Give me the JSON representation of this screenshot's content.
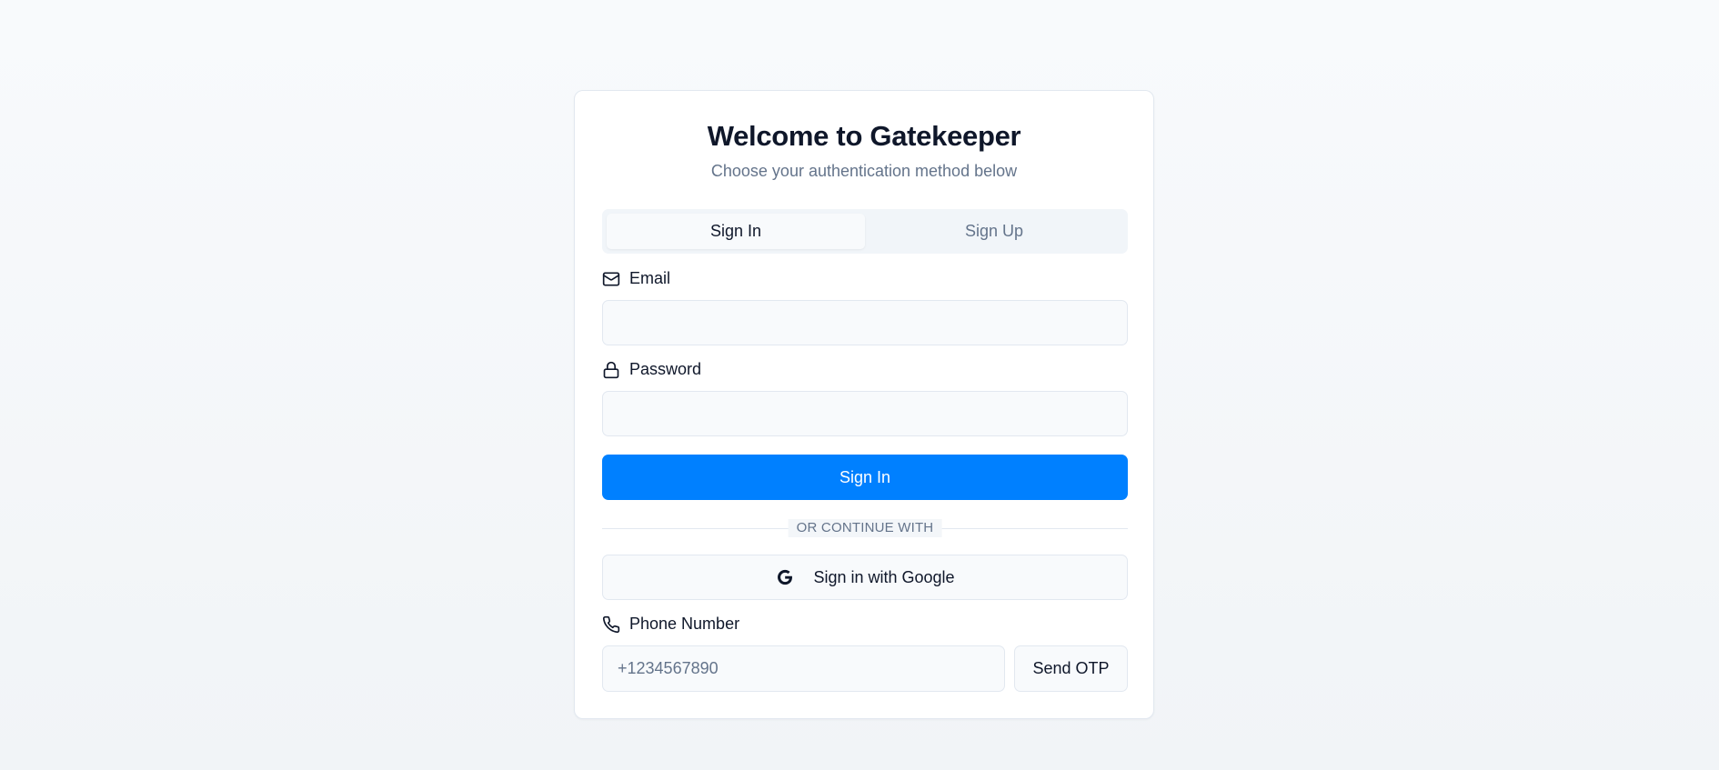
{
  "header": {
    "title": "Welcome to Gatekeeper",
    "subtitle": "Choose your authentication method below"
  },
  "tabs": [
    {
      "label": "Sign In",
      "active": true
    },
    {
      "label": "Sign Up",
      "active": false
    }
  ],
  "email": {
    "label": "Email",
    "icon": "mail-icon",
    "value": "",
    "placeholder": ""
  },
  "password": {
    "label": "Password",
    "icon": "lock-icon",
    "value": "",
    "placeholder": ""
  },
  "submit": {
    "label": "Sign In"
  },
  "divider": {
    "label": "OR CONTINUE WITH"
  },
  "google": {
    "label": "Sign in with Google",
    "icon": "google-icon"
  },
  "phone": {
    "label": "Phone Number",
    "icon": "phone-icon",
    "value": "",
    "placeholder": "+1234567890",
    "button_label": "Send OTP"
  },
  "colors": {
    "primary": "#0080ff",
    "background": "#f8fafc",
    "card": "#ffffff",
    "text": "#0f172a",
    "muted": "#64748b",
    "border": "#e2e8f0"
  }
}
